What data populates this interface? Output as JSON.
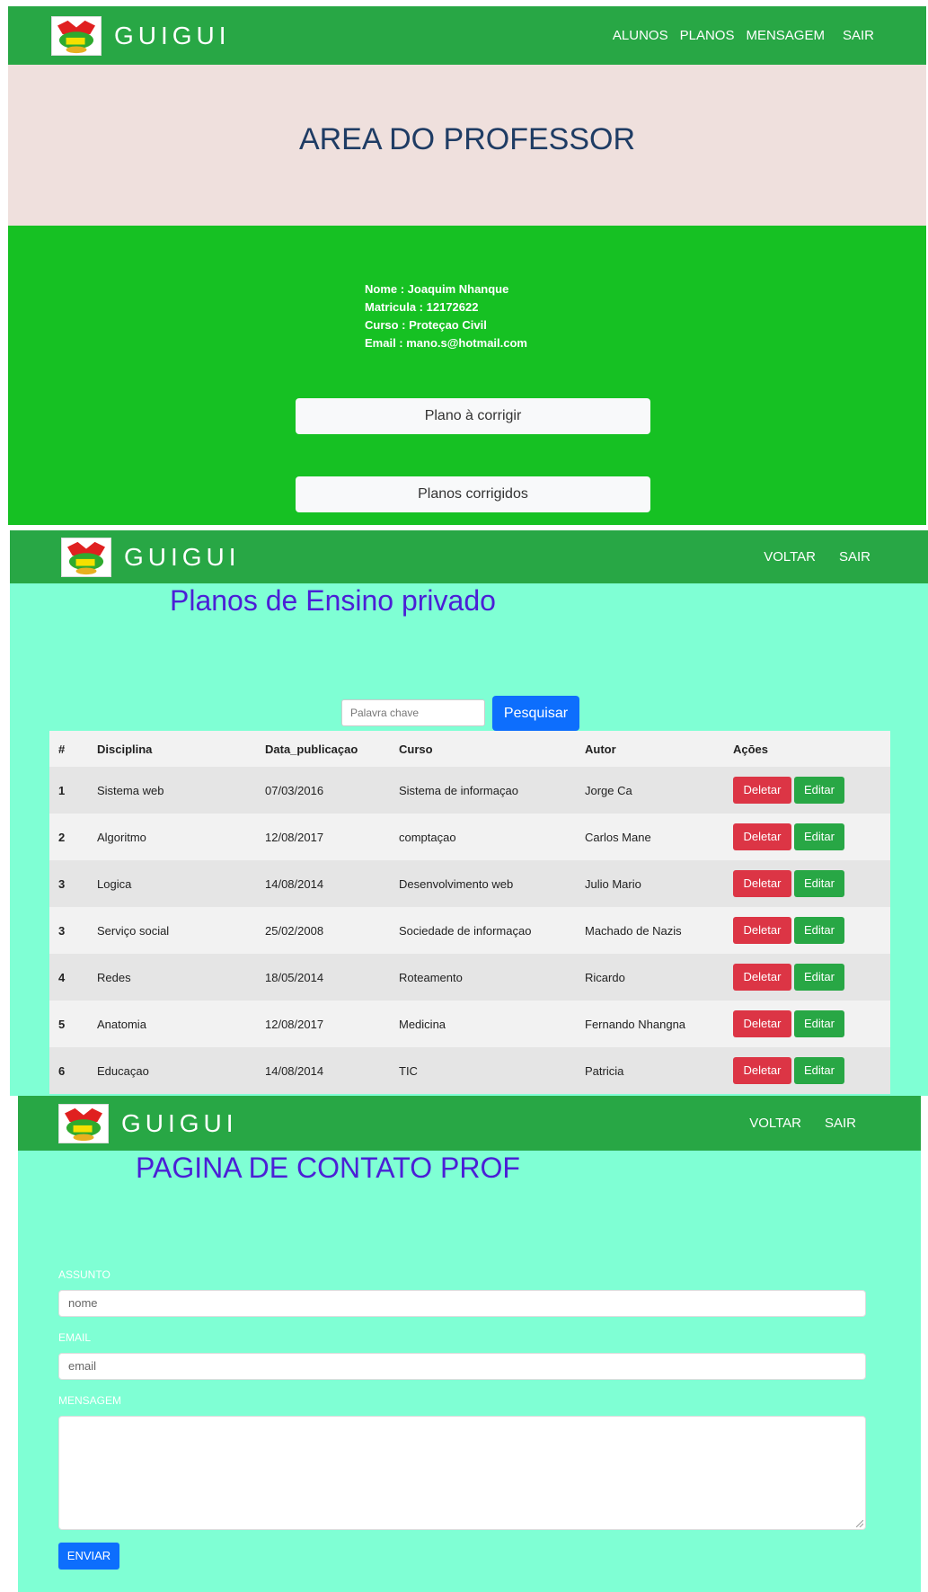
{
  "section1": {
    "nav": {
      "brand": "GUIGUI",
      "links": [
        "ALUNOS",
        "PLANOS",
        "MENSAGEM",
        "SAIR"
      ]
    },
    "hero_title": "AREA DO PROFESSOR",
    "profile": {
      "nome": "Nome : Joaquim Nhanque",
      "matricula": "Matricula : 12172622",
      "curso": "Curso : Proteçao Civil",
      "email": "Email : mano.s@hotmail.com"
    },
    "buttons": {
      "to_correct": "Plano à corrigir",
      "corrected": "Planos corrigidos"
    }
  },
  "section2": {
    "nav": {
      "brand": "GUIGUI",
      "links": [
        "VOLTAR",
        "SAIR"
      ]
    },
    "title": "Planos de Ensino privado",
    "search": {
      "placeholder": "Palavra chave",
      "button": "Pesquisar"
    },
    "table": {
      "headers": [
        "#",
        "Disciplina",
        "Data_publicaçao",
        "Curso",
        "Autor",
        "Açōes"
      ],
      "rows": [
        [
          "1",
          "Sistema web",
          "07/03/2016",
          "Sistema de informaçao",
          "Jorge Ca"
        ],
        [
          "2",
          "Algoritmo",
          "12/08/2017",
          "comptaçao",
          "Carlos Mane"
        ],
        [
          "3",
          "Logica",
          "14/08/2014",
          "Desenvolvimento web",
          "Julio Mario"
        ],
        [
          "3",
          "Serviço social",
          "25/02/2008",
          "Sociedade de informaçao",
          "Machado de Nazis"
        ],
        [
          "4",
          "Redes",
          "18/05/2014",
          "Roteamento",
          "Ricardo"
        ],
        [
          "5",
          "Anatomia",
          "12/08/2017",
          "Medicina",
          "Fernando Nhangna"
        ],
        [
          "6",
          "Educaçao",
          "14/08/2014",
          "TIC",
          "Patricia"
        ]
      ],
      "delete_label": "Deletar",
      "edit_label": "Editar"
    }
  },
  "section3": {
    "nav": {
      "brand": "GUIGUI",
      "links": [
        "VOLTAR",
        "SAIR"
      ]
    },
    "title": "PAGINA DE CONTATO PROF",
    "form": {
      "subject_label": "ASSUNTO",
      "subject_placeholder": "nome",
      "email_label": "EMAIL",
      "email_placeholder": "email",
      "message_label": "MENSAGEM",
      "submit": "ENVIAR"
    }
  },
  "colors": {
    "nav": "#28a745",
    "hero": "#efe0dd",
    "profile_bg": "#16c123",
    "aquamarine": "#7fffd4",
    "title_purple": "#4b1fd6",
    "primary": "#0d6efd",
    "danger": "#dc3545"
  }
}
